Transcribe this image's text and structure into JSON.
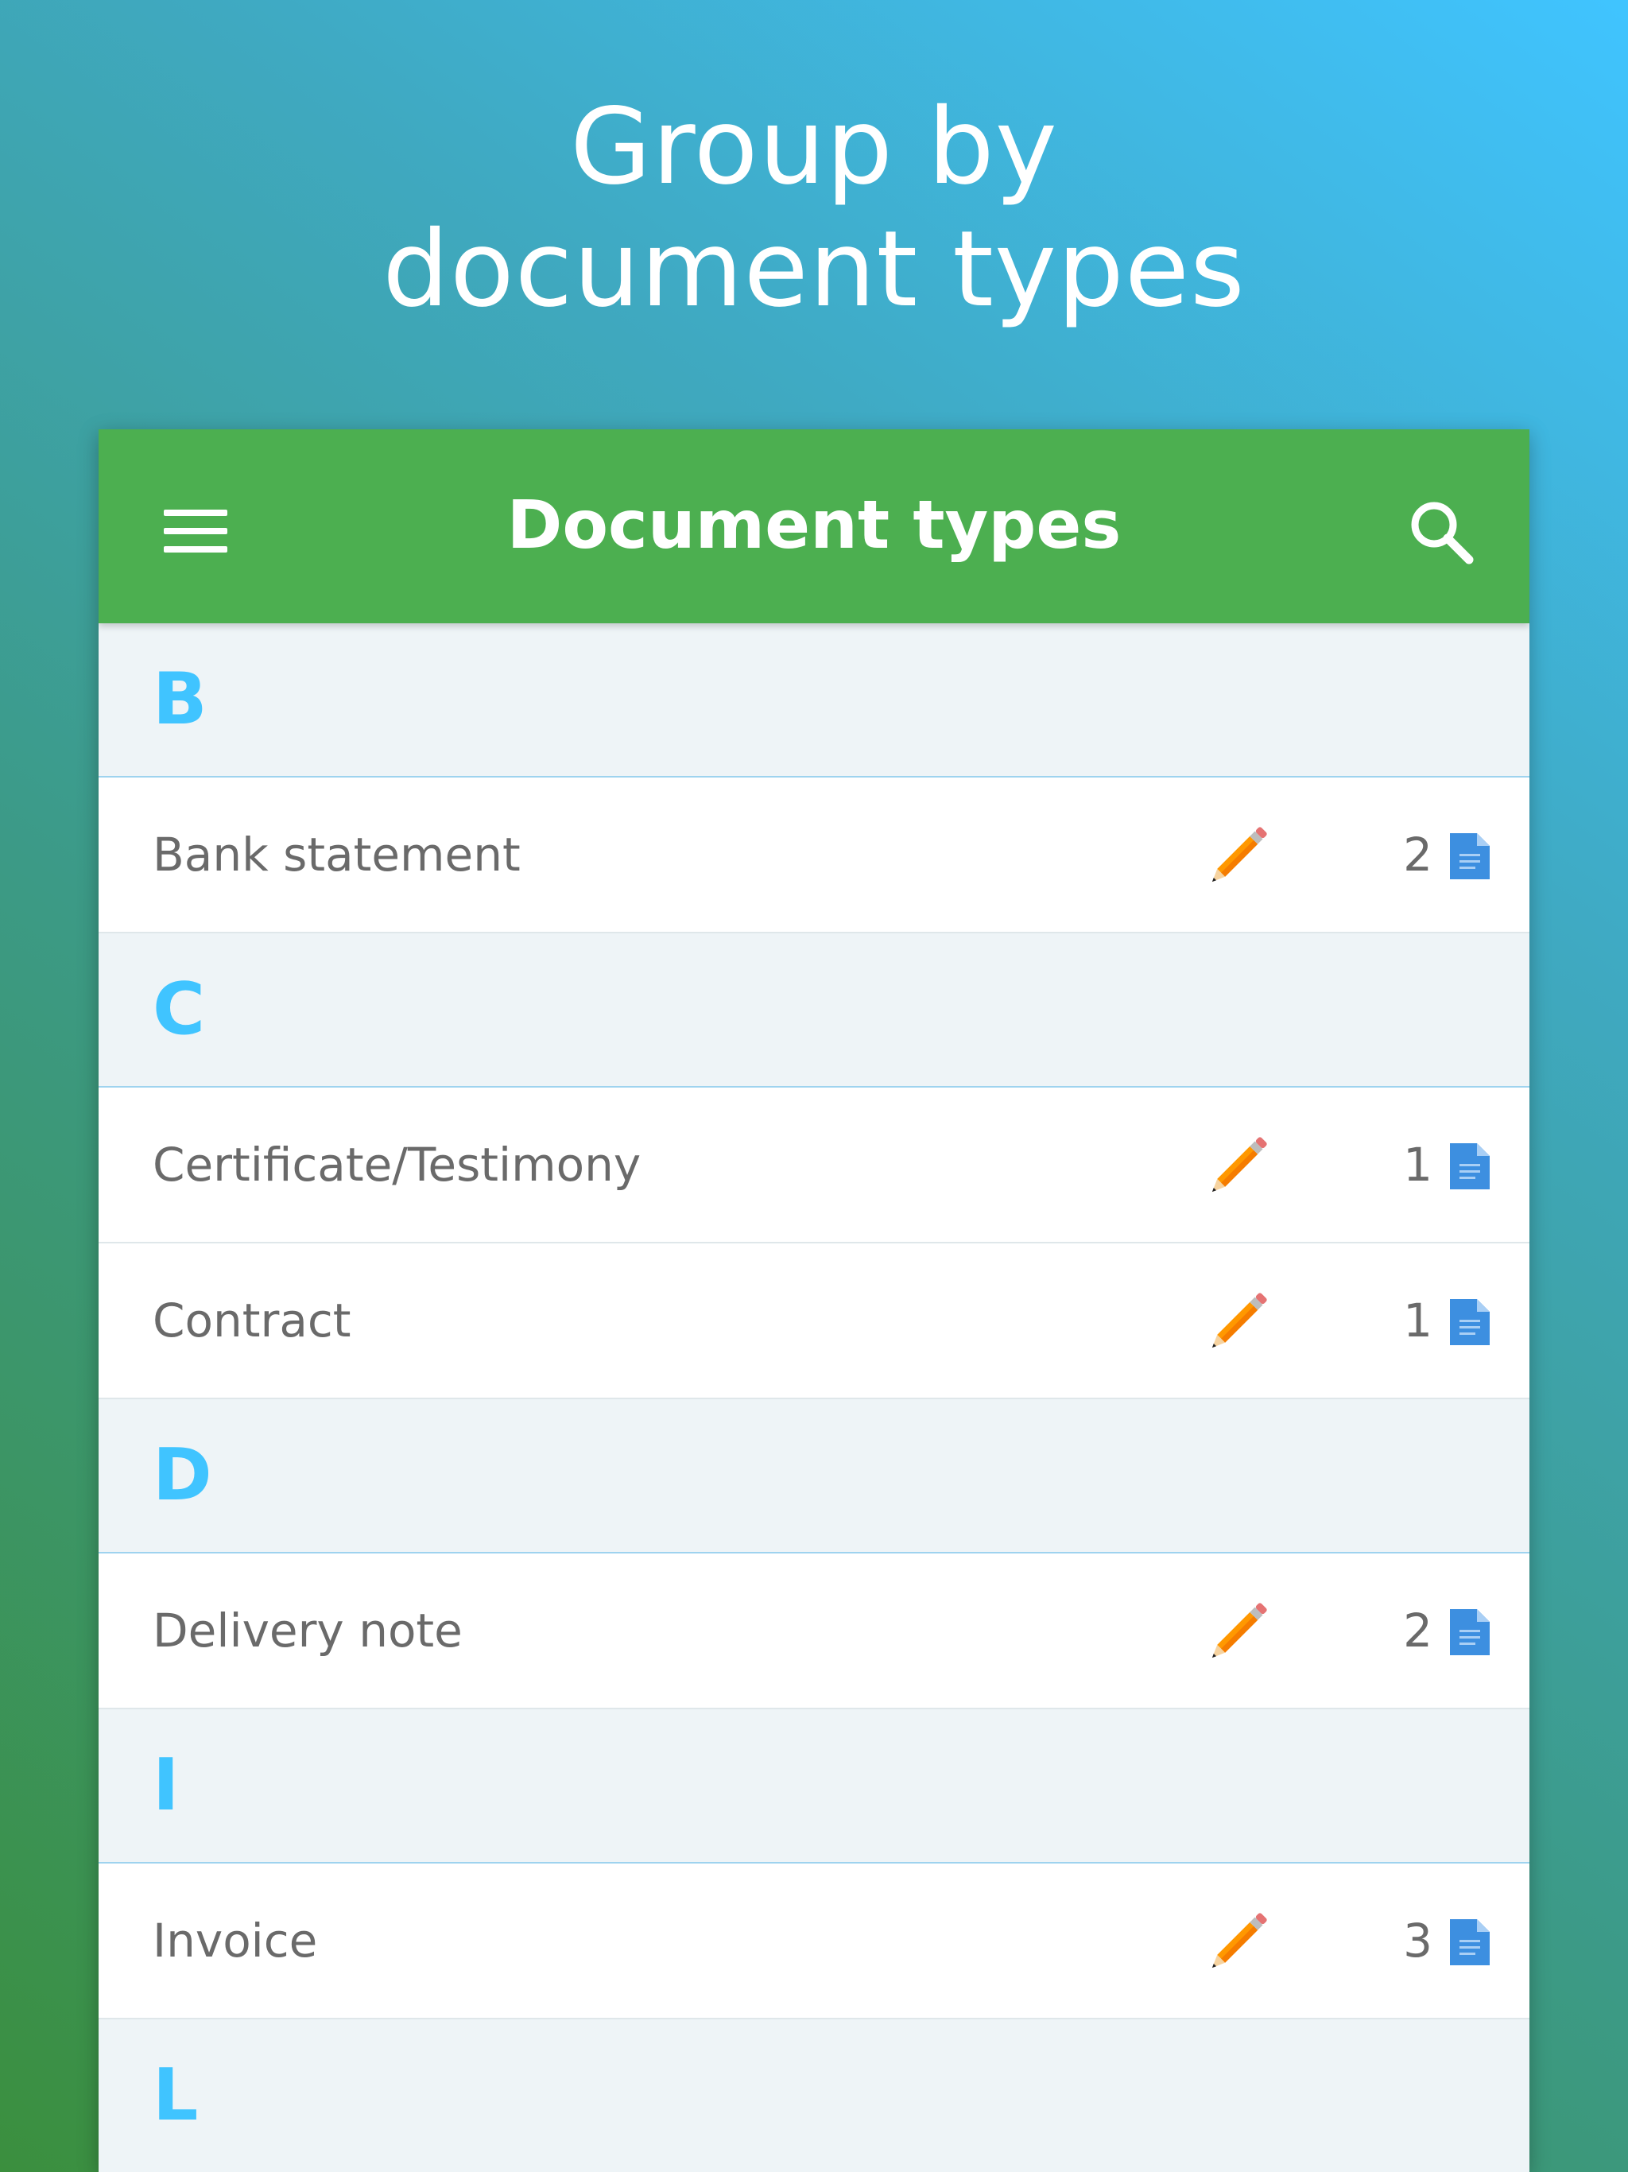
{
  "promo": {
    "line1": "Group by",
    "line2": "document types"
  },
  "appbar": {
    "title": "Document types",
    "menu_icon": "menu-icon",
    "search_icon": "search-icon",
    "color": "#4caf50"
  },
  "colors": {
    "accent_letter": "#40c4ff",
    "pencil": "#ff9800",
    "document": "#3d8fe0"
  },
  "sections": [
    {
      "letter": "B",
      "items": [
        {
          "label": "Bank statement",
          "count": "2"
        }
      ]
    },
    {
      "letter": "C",
      "items": [
        {
          "label": "Certificate/Testimony",
          "count": "1"
        },
        {
          "label": "Contract",
          "count": "1"
        }
      ]
    },
    {
      "letter": "D",
      "items": [
        {
          "label": "Delivery note",
          "count": "2"
        }
      ]
    },
    {
      "letter": "I",
      "items": [
        {
          "label": "Invoice",
          "count": "3"
        }
      ]
    },
    {
      "letter": "L",
      "items": []
    }
  ]
}
